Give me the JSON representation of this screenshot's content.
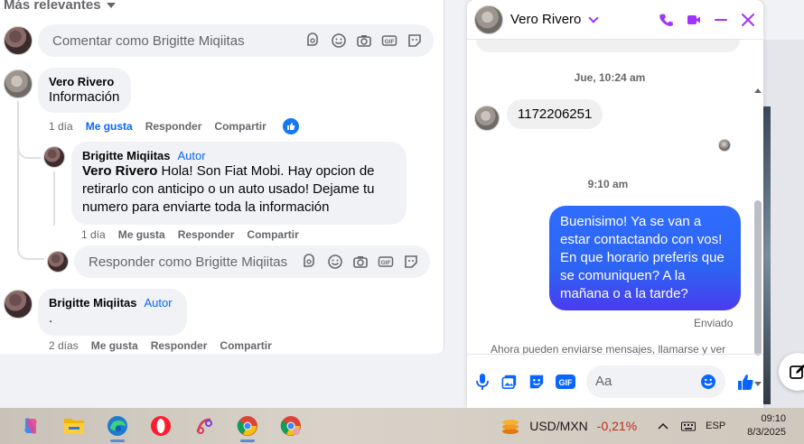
{
  "comments": {
    "sort_label": "Más relevantes",
    "top_input_placeholder": "Comentar como Brigitte Miqiitas",
    "c1": {
      "author": "Vero Rivero",
      "text": "Información",
      "time": "1 día",
      "like": "Me gusta",
      "reply": "Responder",
      "share": "Compartir"
    },
    "c2": {
      "author": "Brigitte Miqiitas",
      "badge": "Autor",
      "mention": "Vero Rivero",
      "text": " Hola! Son Fiat Mobi. Hay opcion de retirarlo con anticipo o un auto usado! Dejame tu numero para enviarte toda la información",
      "time": "1 día",
      "like": "Me gusta",
      "reply": "Responder",
      "share": "Compartir"
    },
    "reply_input_placeholder": "Responder como Brigitte Miqiitas",
    "c3": {
      "author": "Brigitte Miqiitas",
      "badge": "Autor",
      "text": ".",
      "time": "2 días",
      "like": "Me gusta",
      "reply": "Responder",
      "share": "Compartir"
    }
  },
  "chat": {
    "contact_name": "Vero Rivero",
    "ts1": "Jue, 10:24 am",
    "msg_in": "1172206251",
    "ts2": "9:10 am",
    "msg_out": "Buenisimo! Ya se van a estar contactando con vos! En que horario preferis que se comuniquen? A la mañana o a la tarde?",
    "status": "Enviado",
    "notice": "Ahora pueden enviarse mensajes, llamarse y ver",
    "input_placeholder": "Aa",
    "accent_color": "#a033ff",
    "outgoing_color": "#2f6dff"
  },
  "taskbar": {
    "ticker_symbol": "USD/MXN",
    "ticker_change": "-0,21%",
    "language": "ESP",
    "time": "09:10",
    "date": "8/3/2025"
  }
}
